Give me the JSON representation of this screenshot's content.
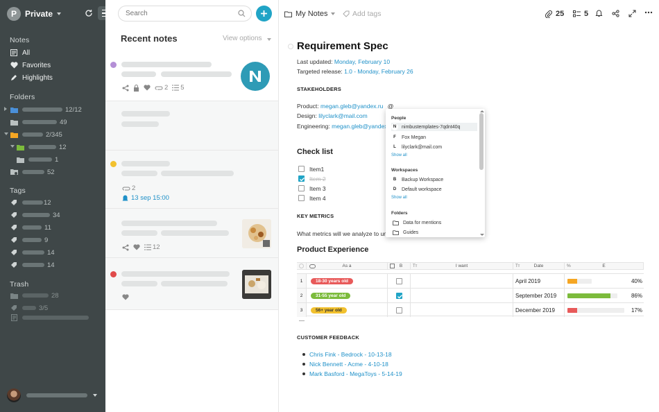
{
  "sidebar": {
    "workspace_initial": "P",
    "workspace_name": "Private",
    "notes_header": "Notes",
    "notes_items": [
      {
        "label": "All",
        "icon": "notes-list-icon"
      },
      {
        "label": "Favorites",
        "icon": "heart-icon"
      },
      {
        "label": "Highlights",
        "icon": "pen-icon"
      }
    ],
    "folders_header": "Folders",
    "folder_counts": [
      "12/12",
      "49",
      "2/345",
      "12",
      "1",
      "52"
    ],
    "tags_header": "Tags",
    "tag_counts": [
      "12",
      "34",
      "11",
      "9",
      "14",
      "14"
    ],
    "trash_header": "Trash",
    "trash_counts": [
      "28",
      "3/5",
      ""
    ]
  },
  "list": {
    "search_placeholder": "Search",
    "title": "Recent notes",
    "view_options": "View options",
    "cards": [
      {
        "dot": "#b48fd6",
        "meta_attach": "2",
        "meta_list": "5"
      },
      {
        "dot": "",
        "meta_attach": "",
        "meta_list": ""
      },
      {
        "dot": "#f2c12e",
        "meta_attach": "2",
        "reminder": "13 sep 15:00"
      },
      {
        "dot": "",
        "meta_list": "12"
      },
      {
        "dot": "#e04b4b"
      }
    ]
  },
  "toolbar": {
    "notebook": "My Notes",
    "add_tags": "Add tags",
    "attach_count": "25",
    "list_count": "5"
  },
  "doc": {
    "title": "Requirement Spec",
    "last_updated_label": "Last updated:",
    "last_updated_value": "Monday, February 10",
    "target_label": "Targeted release:",
    "target_value": "1.0 - Monday, February 26",
    "stakeholders": "STAKEHOLDERS",
    "product_label": "Product:",
    "product_value": "megan.gleb@yandex.ru",
    "product_mention": "@",
    "design_label": "Design:",
    "design_value": "lilyclark@mail.com",
    "engineering_label": "Engineering:",
    "engineering_value": "megan.gleb@yandex.ru",
    "checklist_title": "Check list",
    "checklist": [
      {
        "label": "Item1",
        "checked": false
      },
      {
        "label": "Item 2",
        "checked": true
      },
      {
        "label": "Item 3",
        "checked": false
      },
      {
        "label": "Item 4",
        "checked": false
      }
    ],
    "key_metrics": "KEY METRICS",
    "metrics_text": "What metrics will we analyze to und",
    "product_experience": "Product Experience",
    "customer_feedback": "CUSTOMER FEEDBACK",
    "feedback": [
      "Chris Fink - Bedrock - 10-13-18",
      "Nick Bennett - Acme - 4-10-18",
      "Mark Basford - MegaToys - 5-14-19"
    ]
  },
  "mention_popup": {
    "people_header": "People",
    "people": [
      {
        "initial": "N",
        "name": "nimbustemplates-7qdnt40q"
      },
      {
        "initial": "F",
        "name": "Fox Megan"
      },
      {
        "initial": "L",
        "name": "lilyclark@mail.com"
      }
    ],
    "show_all_1": "Show all",
    "workspaces_header": "Workspaces",
    "workspaces": [
      {
        "initial": "B",
        "name": "Backup Workspace"
      },
      {
        "initial": "D",
        "name": "Default workspace"
      }
    ],
    "show_all_2": "Show all",
    "folders_header": "Folders",
    "folders": [
      "Data for mentions",
      "Guides"
    ]
  },
  "table": {
    "headers": [
      "As a",
      "B",
      "I want",
      "Date",
      "E"
    ],
    "rows": [
      {
        "num": "1",
        "tag": "18-30 years old",
        "tag_color": "#e85a5a",
        "checked": false,
        "date": "April 2019",
        "progress": 0.4,
        "pct": "40%",
        "bar_color": "#f5a623"
      },
      {
        "num": "2",
        "tag": "31-55 year old",
        "tag_color": "#7cbb3c",
        "checked": true,
        "date": "September 2019",
        "progress": 0.86,
        "pct": "86%",
        "bar_color": "#7cbb3c"
      },
      {
        "num": "3",
        "tag": "56+ year old",
        "tag_color": "#f2c12e",
        "checked": false,
        "date": "December 2019",
        "progress": 0.17,
        "pct": "17%",
        "bar_color": "#e85a5a"
      }
    ]
  }
}
